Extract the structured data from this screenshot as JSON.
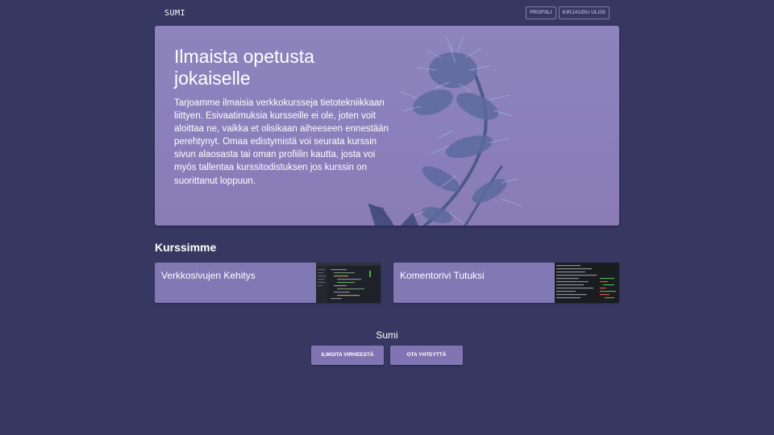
{
  "header": {
    "brand": "SUMI",
    "profile_label": "PROFIILI",
    "logout_label": "KIRJAUDU ULOS"
  },
  "hero": {
    "title": "Ilmaista opetusta jokaiselle",
    "text": "Tarjoamme ilmaisia verkkokursseja tietotekniikkaan liittyen. Esivaatimuksia kursseille ei ole, joten voit aloittaa ne, vaikka et olisikaan aiheeseen ennestään perehtynyt. Omaa edistymistä voi seurata kurssin sivun alaosasta tai oman profiilin kautta, josta voi myös tallentaa kurssitodistuksen jos kurssin on suorittanut loppuun."
  },
  "courses": {
    "heading": "Kurssimme",
    "items": [
      {
        "title": "Verkkosivujen Kehitys",
        "thumb_icon": "code-editor-screenshot"
      },
      {
        "title": "Komentorivi Tutuksi",
        "thumb_icon": "terminal-screenshot"
      }
    ]
  },
  "footer": {
    "title": "Sumi",
    "report_label": "ILMOITA VIRHEESTÄ",
    "contact_label": "OTA YHTEYTTÄ"
  },
  "colors": {
    "background": "#373862",
    "hero": "#8a80bb",
    "card": "#8178b4",
    "button": "#8075b2"
  }
}
